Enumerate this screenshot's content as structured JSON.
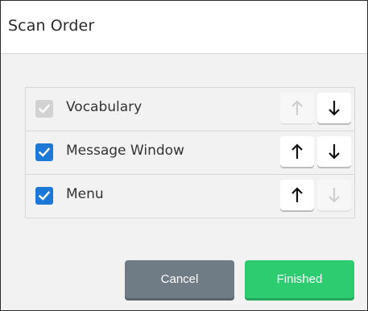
{
  "dialog": {
    "title": "Scan Order"
  },
  "scan_items": [
    {
      "label": "Vocabulary",
      "checked": true,
      "check_disabled": true,
      "up_enabled": false,
      "down_enabled": true
    },
    {
      "label": "Message Window",
      "checked": true,
      "check_disabled": false,
      "up_enabled": true,
      "down_enabled": true
    },
    {
      "label": "Menu",
      "checked": true,
      "check_disabled": false,
      "up_enabled": true,
      "down_enabled": false
    }
  ],
  "icons": {
    "checkbox": "check-icon",
    "move_up": "arrow-up-icon",
    "move_down": "arrow-down-icon"
  },
  "footer": {
    "cancel_label": "Cancel",
    "finished_label": "Finished"
  },
  "colors": {
    "checked": "#1e78d7",
    "disabled_check": "#d2d2d2",
    "cancel": "#707c85",
    "finished": "#2ecc71",
    "arrow_active": "#111111",
    "arrow_disabled": "#cfcfcf"
  }
}
